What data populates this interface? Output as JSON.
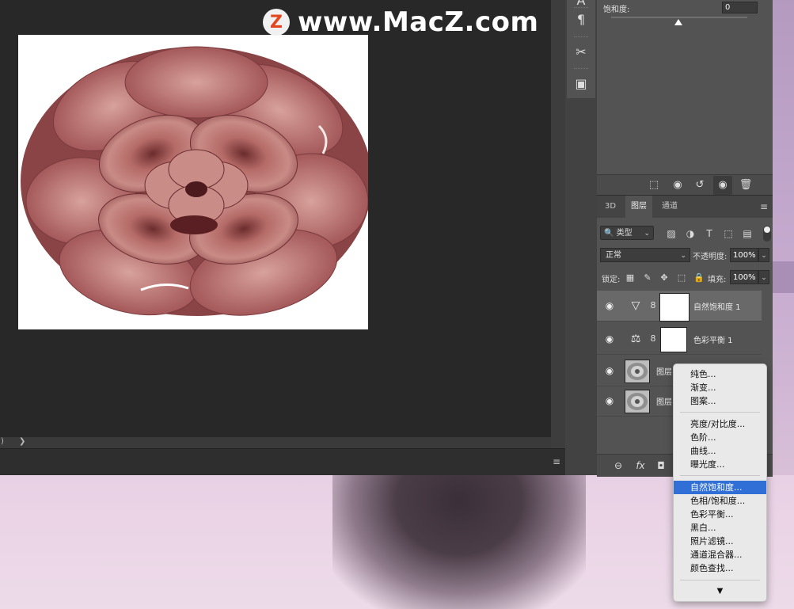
{
  "watermark": {
    "logo_letter": "Z",
    "text": "www.MacZ.com"
  },
  "status_bar": {
    "left_glyph": ")",
    "arrow": "❯"
  },
  "timeline": {
    "menu_icon": "≡"
  },
  "tools": {
    "items": [
      "paragraph-icon",
      "tools-icon",
      "layer-comp-icon"
    ]
  },
  "properties": {
    "saturation_label": "饱和度:",
    "saturation_value": "0",
    "saturation_level": 0
  },
  "layers_panel": {
    "tabs": [
      "3D",
      "图层",
      "通道"
    ],
    "filter_kind": "类型",
    "blend_mode": "正常",
    "opacity_label": "不透明度:",
    "opacity_value": "100%",
    "lock_label": "锁定:",
    "fill_label": "填充:",
    "fill_value": "100%",
    "layers": [
      {
        "name": "自然饱和度 1",
        "type": "adjustment",
        "icon": "vibrance-icon",
        "selected": true
      },
      {
        "name": "色彩平衡 1",
        "type": "adjustment",
        "icon": "color-balance-icon",
        "selected": false
      },
      {
        "name": "图层",
        "type": "pixel",
        "selected": false
      },
      {
        "name": "图层",
        "type": "pixel",
        "selected": false
      }
    ]
  },
  "adjustment_menu": {
    "group1": [
      "纯色...",
      "渐变...",
      "图案..."
    ],
    "group2": [
      "亮度/对比度...",
      "色阶...",
      "曲线...",
      "曝光度..."
    ],
    "group3": [
      "自然饱和度...",
      "色相/饱和度...",
      "色彩平衡...",
      "黑白...",
      "照片滤镜...",
      "通道混合器...",
      "颜色查找..."
    ],
    "highlighted": "自然饱和度...",
    "more_arrow": "▼"
  },
  "colors": {
    "highlight": "#2f6fd6",
    "panel": "#535353",
    "canvas": "#282828"
  }
}
